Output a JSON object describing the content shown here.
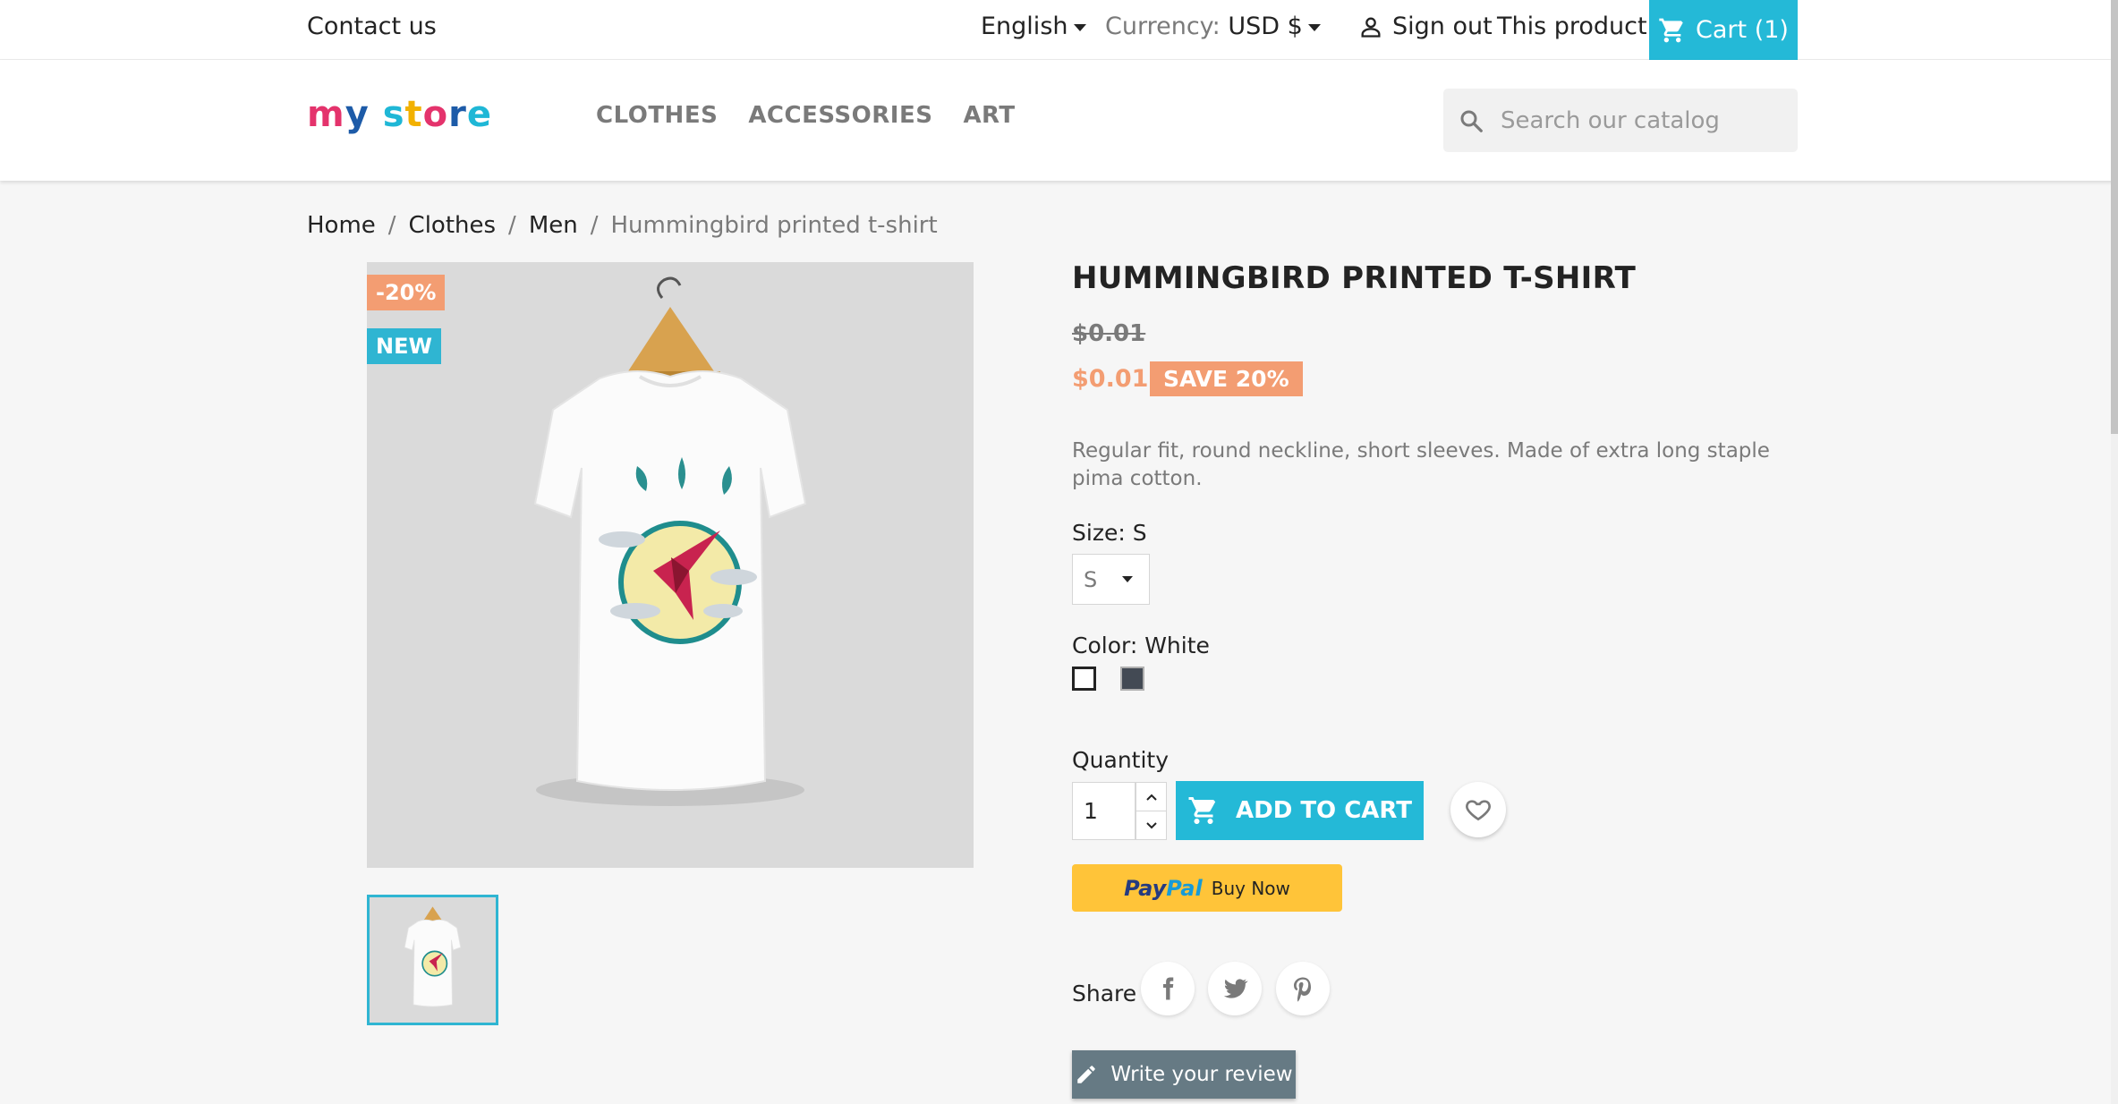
{
  "topbar": {
    "contact": "Contact us",
    "language": "English",
    "currency_label": "Currency:",
    "currency_value": "USD $",
    "sign_out": "Sign out",
    "this_product": "This product",
    "cart": "Cart (1)"
  },
  "header": {
    "logo_letters": [
      "m",
      "y",
      " ",
      "s",
      "t",
      "o",
      "r",
      "e"
    ],
    "logo_colors": [
      "#e4336c",
      "#1d5ba8",
      "",
      "#1fb7d6",
      "#f2b100",
      "#e4336c",
      "#1d5ba8",
      "#1fb7d6"
    ],
    "nav": [
      "CLOTHES",
      "ACCESSORIES",
      "ART"
    ],
    "search_placeholder": "Search our catalog"
  },
  "breadcrumb": {
    "items": [
      "Home",
      "Clothes",
      "Men"
    ],
    "current": "Hummingbird printed t-shirt",
    "separator": "/"
  },
  "product": {
    "flag_discount": "-20%",
    "flag_new": "NEW",
    "title": "HUMMINGBIRD PRINTED T-SHIRT",
    "old_price": "$0.01",
    "price": "$0.01",
    "save_label": "SAVE 20%",
    "description": "Regular fit, round neckline, short sleeves. Made of extra long staple pima cotton.",
    "size_label": "Size: S",
    "size_value": "S",
    "color_label": "Color: White",
    "colors": [
      "#ffffff",
      "#434a54"
    ],
    "quantity_label": "Quantity",
    "quantity_value": "1",
    "add_to_cart": "ADD TO CART",
    "paypal_pay": "Pay",
    "paypal_pal": "Pal",
    "paypal_buy_now": "Buy Now",
    "share_label": "Share",
    "write_review": "Write your review"
  },
  "colors": {
    "accent": "#24b9d7",
    "discount": "#f39d72",
    "paypal": "#ffc439",
    "review_button": "#667a84"
  }
}
